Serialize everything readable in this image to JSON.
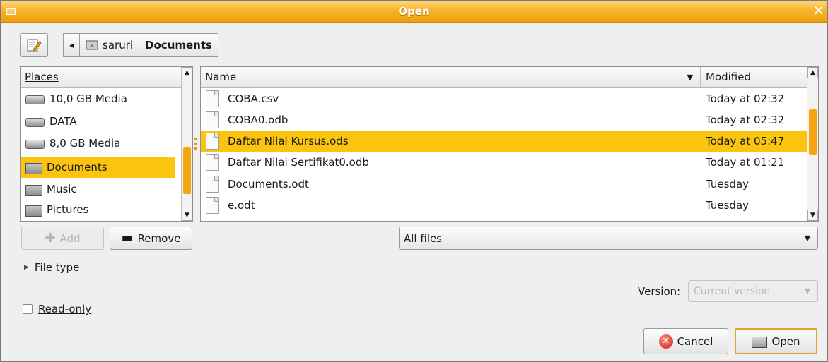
{
  "window": {
    "title": "Open",
    "close_glyph": "✕"
  },
  "toolbar": {
    "edit_icon": "pencil-icon",
    "back_glyph": "◂"
  },
  "breadcrumb": [
    {
      "label": "saruri",
      "icon": "home-folder-icon"
    },
    {
      "label": "Documents",
      "active": true
    }
  ],
  "places": {
    "header": "Places",
    "items": [
      {
        "label": "10,0 GB Media",
        "icon": "drive-icon"
      },
      {
        "label": "DATA",
        "icon": "drive-icon"
      },
      {
        "label": "8,0 GB Media",
        "icon": "drive-icon"
      },
      {
        "label": "Documents",
        "icon": "folder-icon",
        "selected": true
      },
      {
        "label": "Music",
        "icon": "folder-icon"
      },
      {
        "label": "Pictures",
        "icon": "folder-icon"
      }
    ],
    "add_label": "Add",
    "remove_label": "Remove"
  },
  "files": {
    "columns": {
      "name": "Name",
      "modified": "Modified"
    },
    "rows": [
      {
        "name": "COBA.csv",
        "modified": "Today at 02:32"
      },
      {
        "name": "COBA0.odb",
        "modified": "Today at 02:32"
      },
      {
        "name": "Daftar Nilai Kursus.ods",
        "modified": "Today at 05:47",
        "selected": true
      },
      {
        "name": "Daftar Nilai Sertifikat0.odb",
        "modified": "Today at 01:21"
      },
      {
        "name": "Documents.odt",
        "modified": "Tuesday"
      },
      {
        "name": "e.odt",
        "modified": "Tuesday"
      }
    ]
  },
  "filter": {
    "selected": "All files"
  },
  "file_type": {
    "label": "File type"
  },
  "version": {
    "label": "Version:",
    "selected": "Current version"
  },
  "read_only": {
    "label": "Read-only",
    "checked": false
  },
  "actions": {
    "cancel_label": "Cancel",
    "open_label": "Open"
  },
  "colors": {
    "accent": "#fbc40e",
    "titlebar": "#f7b32b",
    "scroll_thumb": "#f7a60f"
  }
}
